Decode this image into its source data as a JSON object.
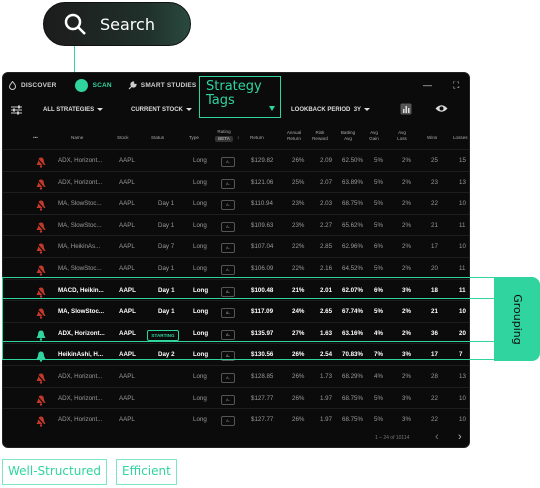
{
  "search": {
    "label": "Search"
  },
  "nav": {
    "tabs": [
      {
        "label": "DISCOVER"
      },
      {
        "label": "SCAN"
      },
      {
        "label": "SMART STUDIES"
      }
    ]
  },
  "filters": {
    "all_strategies": "ALL STRATEGIES",
    "current_stock": "CURRENT STOCK",
    "strategy_tags": "Strategy Tags",
    "lookback_label": "LOOKBACK PERIOD",
    "lookback_value": "3Y"
  },
  "table": {
    "headers": {
      "menu": "•••",
      "name": "Name",
      "stock": "Stock",
      "status": "Status",
      "type": "Type",
      "rating": "Rating",
      "rating_badge": "BETA",
      "return": "Return",
      "annual_return": "Annual Return",
      "risk_reward": "Risk Reward",
      "batting_avg": "Batting Avg",
      "avg_gain": "Avg Gain",
      "avg_loss": "Avg Loss",
      "wins": "Wins",
      "losses": "Losses"
    },
    "rows": [
      {
        "name": "ADX, Horizont...",
        "stock": "AAPL",
        "status": "",
        "type": "Long",
        "return": "$129.82",
        "annual": "26%",
        "risk": "2.09",
        "batting": "62.50%",
        "gain": "5%",
        "loss": "2%",
        "wins": "25",
        "losses": "15",
        "alert": "off",
        "group": false
      },
      {
        "name": "ADX, Horizont...",
        "stock": "AAPL",
        "status": "",
        "type": "Long",
        "return": "$121.06",
        "annual": "25%",
        "risk": "2.07",
        "batting": "63.89%",
        "gain": "5%",
        "loss": "2%",
        "wins": "23",
        "losses": "13",
        "alert": "off",
        "group": false
      },
      {
        "name": "MA, SlowStoc...",
        "stock": "AAPL",
        "status": "Day 1",
        "type": "Long",
        "return": "$110.94",
        "annual": "23%",
        "risk": "2.03",
        "batting": "68.75%",
        "gain": "5%",
        "loss": "2%",
        "wins": "22",
        "losses": "10",
        "alert": "off",
        "group": false
      },
      {
        "name": "MA, SlowStoc...",
        "stock": "AAPL",
        "status": "Day 1",
        "type": "Long",
        "return": "$109.63",
        "annual": "23%",
        "risk": "2.27",
        "batting": "65.62%",
        "gain": "5%",
        "loss": "2%",
        "wins": "21",
        "losses": "11",
        "alert": "off",
        "group": false
      },
      {
        "name": "MA, HeikinAs...",
        "stock": "AAPL",
        "status": "Day 7",
        "type": "Long",
        "return": "$107.04",
        "annual": "22%",
        "risk": "2.85",
        "batting": "62.96%",
        "gain": "6%",
        "loss": "2%",
        "wins": "17",
        "losses": "10",
        "alert": "off",
        "group": false
      },
      {
        "name": "MA, SlowStoc...",
        "stock": "AAPL",
        "status": "Day 1",
        "type": "Long",
        "return": "$106.09",
        "annual": "22%",
        "risk": "2.16",
        "batting": "64.52%",
        "gain": "5%",
        "loss": "2%",
        "wins": "20",
        "losses": "11",
        "alert": "off",
        "group": false
      },
      {
        "name": "MACD, Heikin...",
        "stock": "AAPL",
        "status": "Day 1",
        "type": "Long",
        "return": "$100.48",
        "annual": "21%",
        "risk": "2.01",
        "batting": "62.07%",
        "gain": "6%",
        "loss": "3%",
        "wins": "18",
        "losses": "11",
        "alert": "off",
        "group": true
      },
      {
        "name": "MA, SlowStoc...",
        "stock": "AAPL",
        "status": "Day 1",
        "type": "Long",
        "return": "$117.09",
        "annual": "24%",
        "risk": "2.65",
        "batting": "67.74%",
        "gain": "5%",
        "loss": "2%",
        "wins": "21",
        "losses": "10",
        "alert": "off",
        "group": true
      },
      {
        "name": "ADX, Horizont...",
        "stock": "AAPL",
        "status": "STARTING",
        "type": "Long",
        "return": "$135.97",
        "annual": "27%",
        "risk": "1.63",
        "batting": "63.16%",
        "gain": "4%",
        "loss": "2%",
        "wins": "36",
        "losses": "20",
        "alert": "on",
        "group": true
      },
      {
        "name": "HeikinAshi, H...",
        "stock": "AAPL",
        "status": "Day 2",
        "type": "Long",
        "return": "$130.56",
        "annual": "26%",
        "risk": "2.54",
        "batting": "70.83%",
        "gain": "7%",
        "loss": "3%",
        "wins": "17",
        "losses": "7",
        "alert": "on",
        "group": true
      },
      {
        "name": "ADX, Horizont...",
        "stock": "AAPL",
        "status": "",
        "type": "Long",
        "return": "$128.85",
        "annual": "26%",
        "risk": "1.73",
        "batting": "68.29%",
        "gain": "4%",
        "loss": "2%",
        "wins": "28",
        "losses": "13",
        "alert": "off",
        "group": false
      },
      {
        "name": "ADX, Horizont...",
        "stock": "AAPL",
        "status": "",
        "type": "Long",
        "return": "$127.77",
        "annual": "26%",
        "risk": "1.97",
        "batting": "68.75%",
        "gain": "5%",
        "loss": "3%",
        "wins": "22",
        "losses": "10",
        "alert": "off",
        "group": false
      },
      {
        "name": "ADX, Horizont...",
        "stock": "AAPL",
        "status": "",
        "type": "Long",
        "return": "$127.77",
        "annual": "26%",
        "risk": "1.97",
        "batting": "68.75%",
        "gain": "5%",
        "loss": "3%",
        "wins": "22",
        "losses": "10",
        "alert": "off",
        "group": false
      }
    ],
    "rating_chip": "A-"
  },
  "pagination": {
    "text": "1 – 24 of 10114"
  },
  "grouping_label": "Grouping",
  "tags": [
    "Well-Structured",
    "Efficient"
  ],
  "colors": {
    "accent": "#2fd49f",
    "alert_off": "#c0392b",
    "panel_bg": "#0b0b0b"
  }
}
